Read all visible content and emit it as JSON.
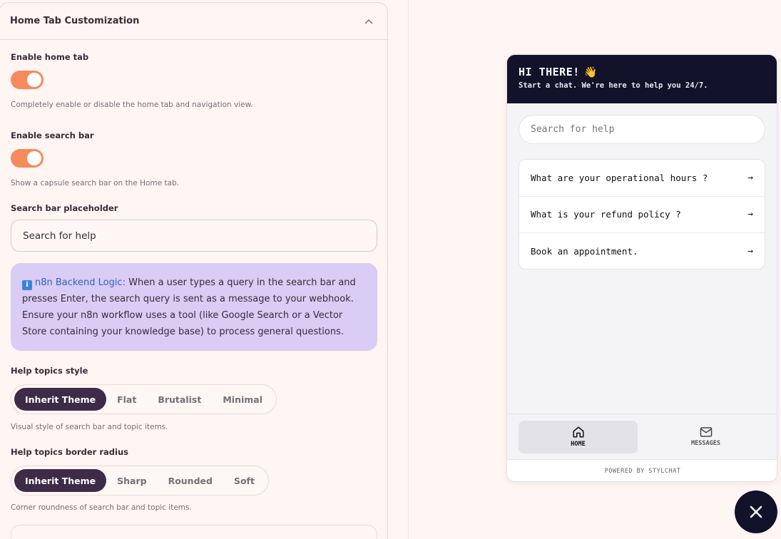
{
  "settings": {
    "panel_title": "Home Tab Customization",
    "enable_home_tab": {
      "label": "Enable home tab",
      "enabled": true,
      "help": "Completely enable or disable the home tab and navigation view."
    },
    "enable_search_bar": {
      "label": "Enable search bar",
      "enabled": true,
      "help": "Show a capsule search bar on the Home tab."
    },
    "search_placeholder": {
      "label": "Search bar placeholder",
      "value": "Search for help"
    },
    "info": {
      "icon": "info-icon",
      "link_text": "n8n Backend Logic:",
      "body": " When a user types a query in the search bar and presses Enter, the search query is sent as a message to your webhook. Ensure your n8n workflow uses a tool (like Google Search or a Vector Store containing your knowledge base) to process general questions."
    },
    "help_topics_style": {
      "label": "Help topics style",
      "options": [
        "Inherit Theme",
        "Flat",
        "Brutalist",
        "Minimal"
      ],
      "selected": "Inherit Theme",
      "help": "Visual style of search bar and topic items."
    },
    "help_topics_radius": {
      "label": "Help topics border radius",
      "options": [
        "Inherit Theme",
        "Sharp",
        "Rounded",
        "Soft"
      ],
      "selected": "Inherit Theme",
      "help": "Corner roundness of search bar and topic items."
    }
  },
  "widget": {
    "title": "HI THERE!",
    "title_emoji": "👋",
    "subtitle": "Start a chat. We're here to help you 24/7.",
    "search_placeholder": "Search for help",
    "topics": [
      "What are your operational hours ?",
      "What is your refund policy ?",
      "Book an appointment."
    ],
    "topic_arrow": "→",
    "nav": {
      "home_label": "HOME",
      "messages_label": "MESSAGES",
      "active": "home"
    },
    "footer": "POWERED BY STYLCHAT"
  },
  "colors": {
    "accent": "#f58a5d",
    "dark": "#12122a",
    "segment_active": "#3d2b47",
    "info_bg": "#d9ccf5"
  }
}
